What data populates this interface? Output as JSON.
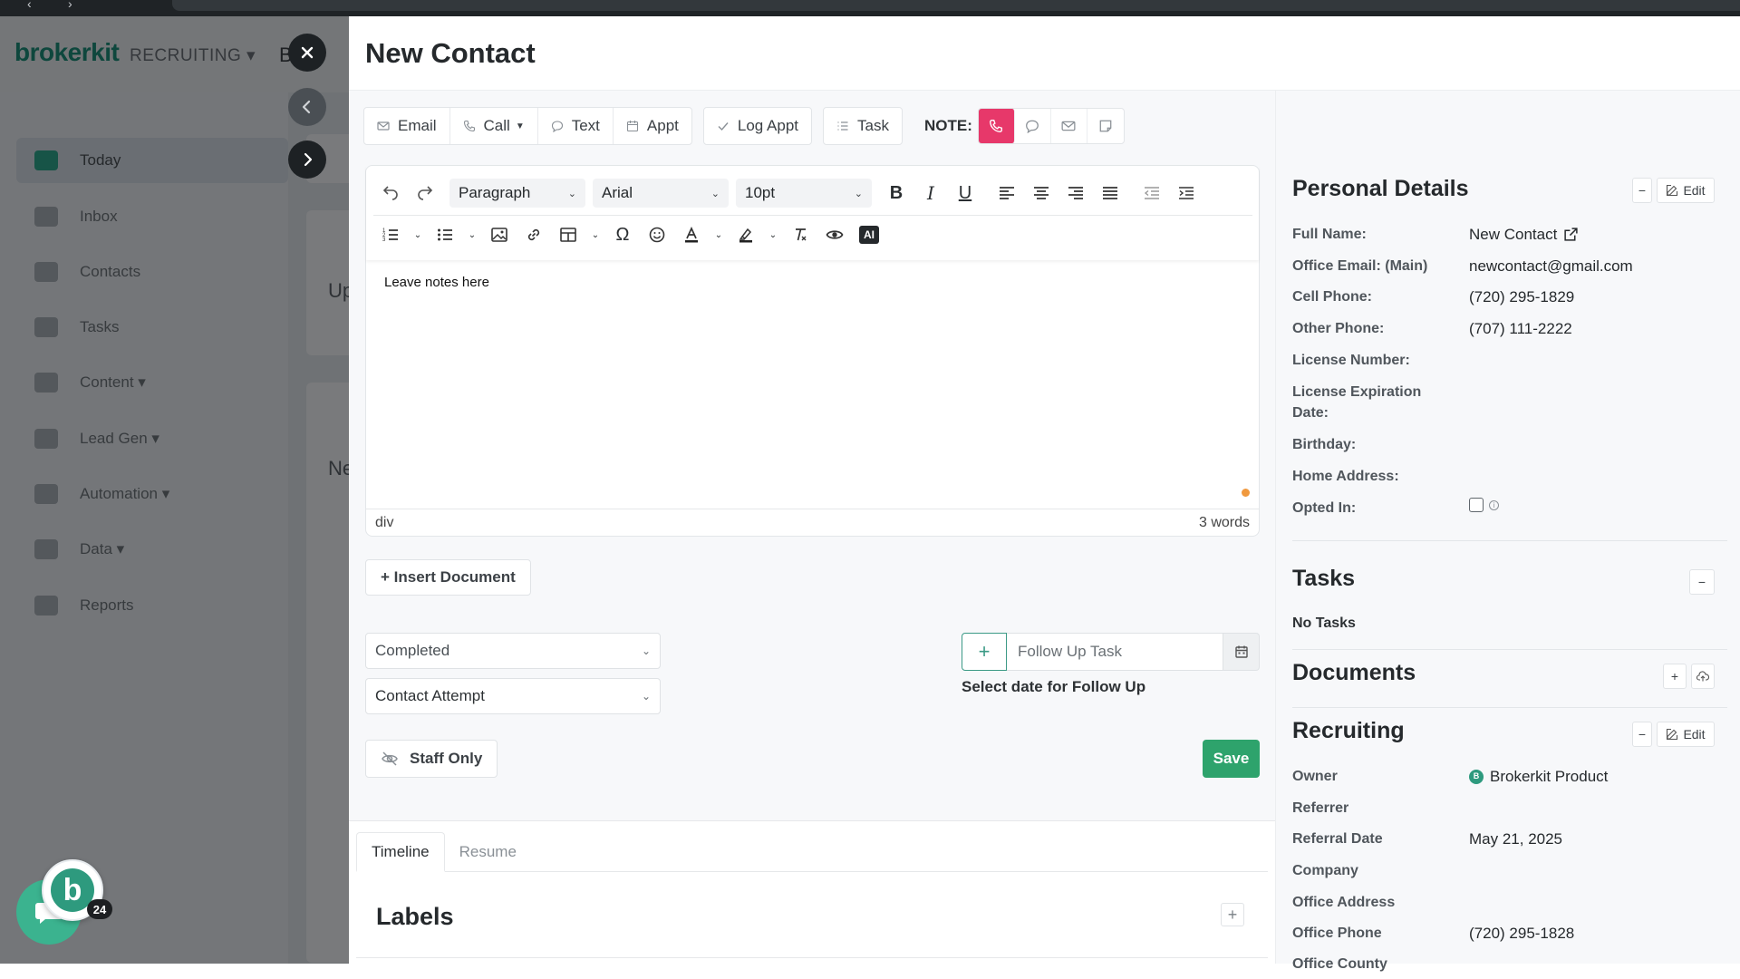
{
  "background": {
    "logo": "brokerkit",
    "module": "RECRUITING ▾",
    "crumb_fragment": "B",
    "nav": [
      {
        "label": "Today",
        "active": true
      },
      {
        "label": "Inbox"
      },
      {
        "label": "Contacts"
      },
      {
        "label": "Tasks"
      },
      {
        "label": "Content ▾"
      },
      {
        "label": "Lead Gen ▾"
      },
      {
        "label": "Automation ▾"
      },
      {
        "label": "Data ▾"
      },
      {
        "label": "Reports"
      }
    ],
    "content_fragments": [
      "Up",
      "Ne"
    ]
  },
  "chat": {
    "badge_count": "24",
    "avatar_letter": "b"
  },
  "modal": {
    "title": "New Contact",
    "actions": {
      "email": "Email",
      "call": "Call",
      "text": "Text",
      "appt": "Appt",
      "log_appt": "Log Appt",
      "task": "Task",
      "note_label": "NOTE:"
    },
    "editor": {
      "block_format": "Paragraph",
      "font_family": "Arial",
      "font_size": "10pt",
      "content": "Leave notes here",
      "path": "div",
      "word_count": "3 words",
      "ai_label": "AI"
    },
    "insert_document": "+ Insert Document",
    "status_select": "Completed",
    "type_select": "Contact Attempt",
    "follow_up": {
      "plus": "+",
      "placeholder": "Follow Up Task",
      "hint": "Select date for Follow Up"
    },
    "staff_only": "Staff Only",
    "save": "Save",
    "tabs": [
      "Timeline",
      "Resume"
    ],
    "labels_title": "Labels",
    "labels_add": "+"
  },
  "details": {
    "personal": {
      "title": "Personal Details",
      "edit": "Edit",
      "fields": [
        {
          "label": "Full Name:",
          "value": "New Contact"
        },
        {
          "label": "Office Email: (Main)",
          "value": "newcontact@gmail.com"
        },
        {
          "label": "Cell Phone:",
          "value": "(720) 295-1829"
        },
        {
          "label": "Other Phone:",
          "value": "(707) 111-2222"
        },
        {
          "label": "License Number:",
          "value": ""
        },
        {
          "label": "License Expiration Date:",
          "value": ""
        },
        {
          "label": "Birthday:",
          "value": ""
        },
        {
          "label": "Home Address:",
          "value": ""
        },
        {
          "label": "Opted In:",
          "value": ""
        }
      ]
    },
    "tasks": {
      "title": "Tasks",
      "empty": "No Tasks"
    },
    "documents": {
      "title": "Documents"
    },
    "recruiting": {
      "title": "Recruiting",
      "edit": "Edit",
      "owner_initial": "B",
      "fields": [
        {
          "label": "Owner",
          "value": "Brokerkit Product"
        },
        {
          "label": "Referrer",
          "value": ""
        },
        {
          "label": "Referral Date",
          "value": "May 21, 2025"
        },
        {
          "label": "Company",
          "value": ""
        },
        {
          "label": "Office Address",
          "value": ""
        },
        {
          "label": "Office Phone",
          "value": "(720) 295-1828"
        },
        {
          "label": "Office County",
          "value": ""
        }
      ]
    }
  }
}
